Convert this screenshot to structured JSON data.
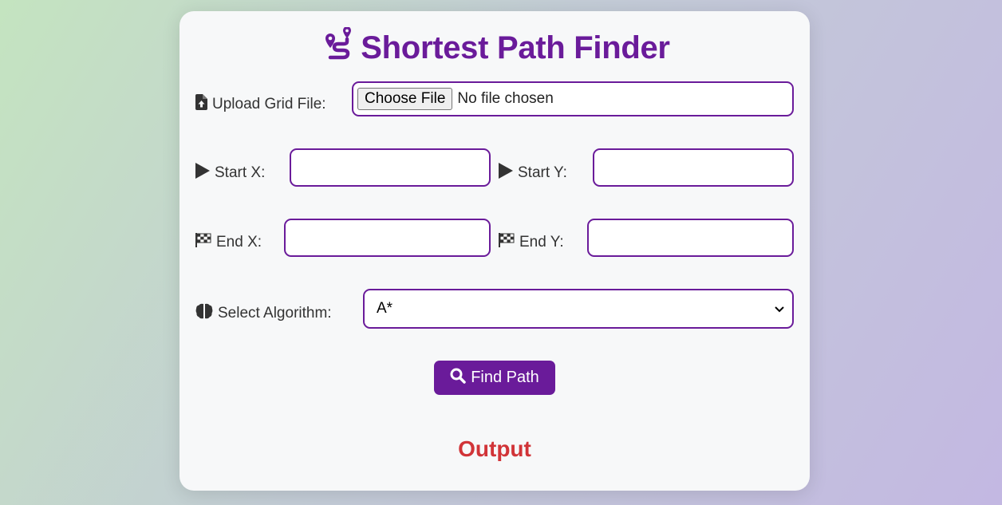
{
  "app": {
    "title": "Shortest Path Finder",
    "title_icon": "route-icon"
  },
  "form": {
    "upload": {
      "label": "Upload Grid File:",
      "icon": "file-upload-icon",
      "button_label": "Choose File",
      "status": "No file chosen"
    },
    "start_x": {
      "label": "Start X:",
      "icon": "play-icon",
      "value": ""
    },
    "start_y": {
      "label": "Start Y:",
      "icon": "play-icon",
      "value": ""
    },
    "end_x": {
      "label": "End X:",
      "icon": "checkered-flag-icon",
      "value": ""
    },
    "end_y": {
      "label": "End Y:",
      "icon": "checkered-flag-icon",
      "value": ""
    },
    "algorithm": {
      "label": "Select Algorithm:",
      "icon": "brain-icon",
      "selected": "A*",
      "arrow_icon": "chevron-down-icon"
    },
    "submit": {
      "label": "Find Path",
      "icon": "search-icon"
    }
  },
  "output": {
    "heading": "Output"
  },
  "colors": {
    "primary": "#6a1b9a",
    "output": "#d13438",
    "card": "#f7f8f9"
  }
}
